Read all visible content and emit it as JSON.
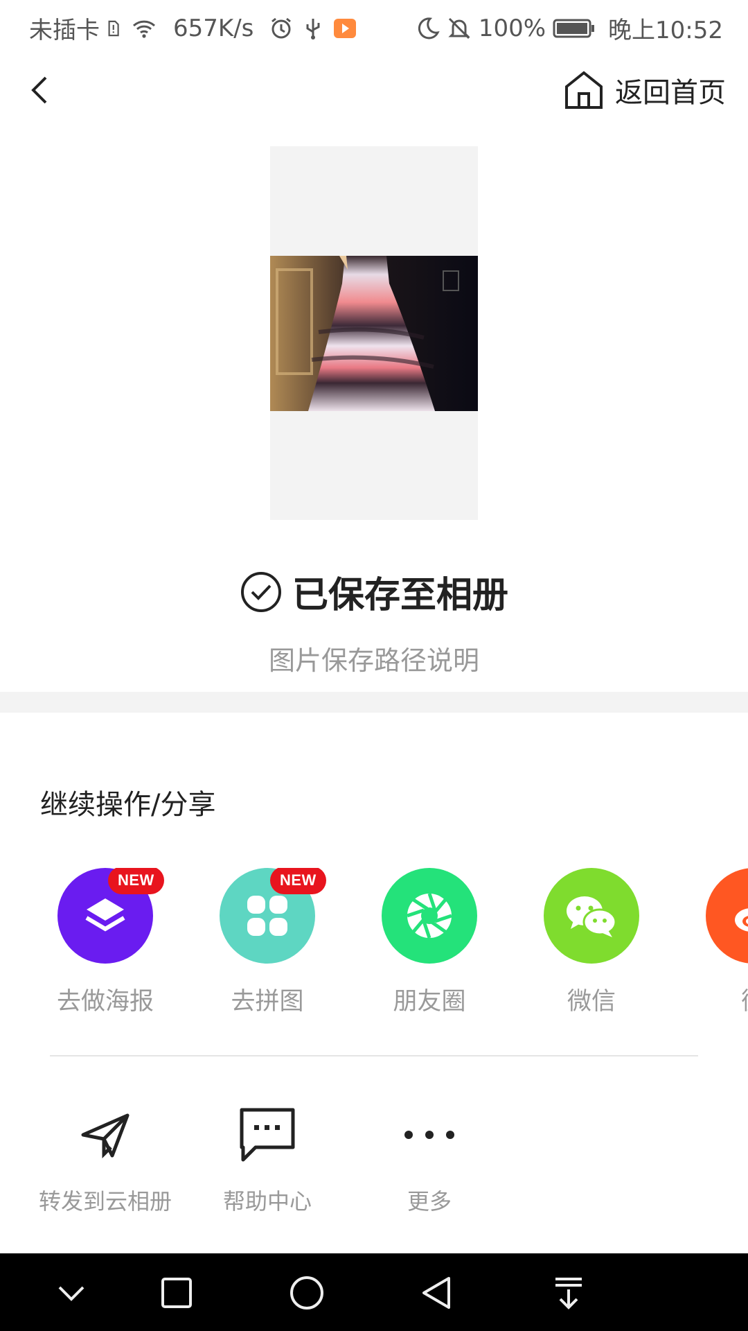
{
  "status_bar": {
    "carrier": "未插卡",
    "speed": "657K/s",
    "battery": "100%",
    "time": "晚上10:52"
  },
  "nav": {
    "back_icon": "chevron-left-icon",
    "home_label": "返回首页",
    "home_icon": "home-icon"
  },
  "saved": {
    "title": "已保存至相册",
    "path_link": "图片保存路径说明"
  },
  "section_title": "继续操作/分享",
  "share_items": [
    {
      "label": "去做海报",
      "icon": "layers-icon",
      "color": "#6a1cf0",
      "badge": "NEW"
    },
    {
      "label": "去拼图",
      "icon": "grid-icon",
      "color": "#5ed6c2",
      "badge": "NEW"
    },
    {
      "label": "朋友圈",
      "icon": "aperture-icon",
      "color": "#24e27a"
    },
    {
      "label": "微信",
      "icon": "wechat-icon",
      "color": "#7fdc2e"
    },
    {
      "label": "微",
      "icon": "weibo-icon",
      "color": "#ff5722"
    }
  ],
  "tools": [
    {
      "label": "转发到云相册",
      "icon": "send-icon"
    },
    {
      "label": "帮助中心",
      "icon": "message-icon"
    },
    {
      "label": "更多",
      "icon": "more-icon"
    }
  ],
  "colors": {
    "badge": "#e8141e",
    "muted_text": "#999999",
    "band": "#f3f3f3"
  }
}
